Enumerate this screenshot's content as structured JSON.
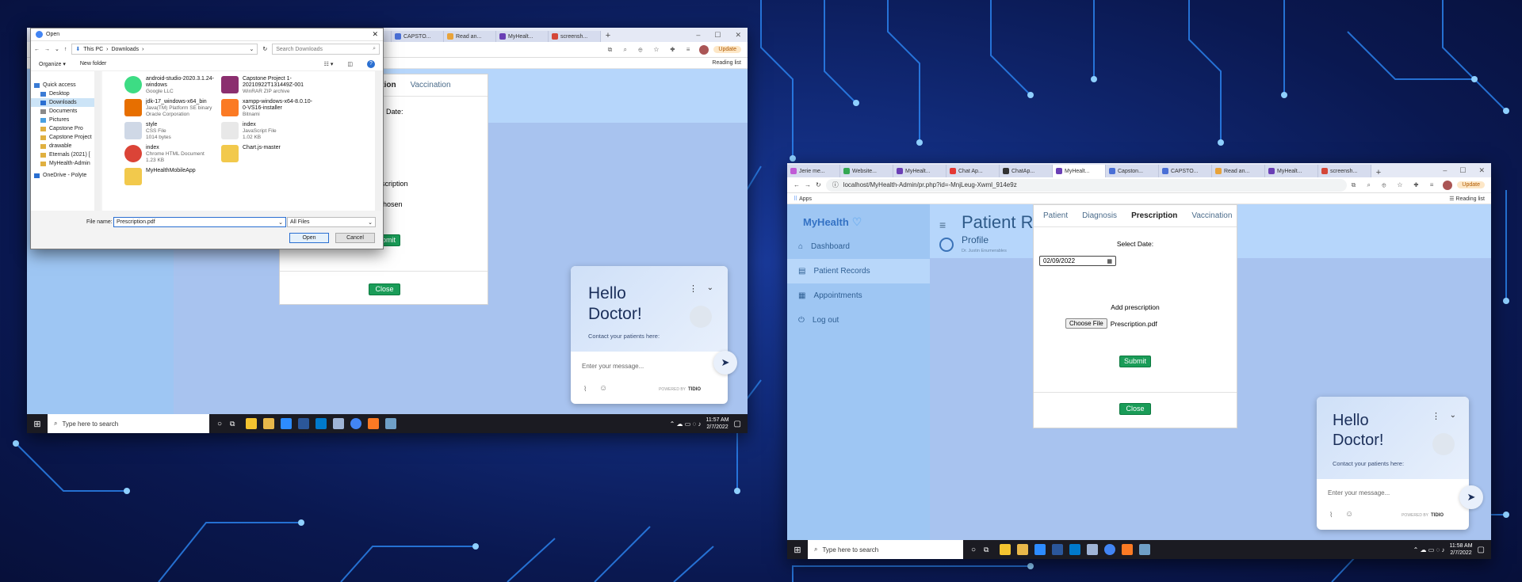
{
  "window1": {
    "tabs": [
      "...",
      "CAPSTO...",
      "Read an...",
      "MyHealt...",
      "screensh..."
    ],
    "reading_list": "Reading list",
    "update_label": "Update",
    "modal": {
      "tabs": [
        "...scription",
        "Vaccination"
      ],
      "select_date_label": "Date:",
      "prescription_label": "scription",
      "no_file_text": "hosen",
      "submit_label": "Submit",
      "close_label": "Close"
    },
    "chat": {
      "greeting": "Hello Doctor!",
      "subtitle": "Contact your patients here:",
      "placeholder": "Enter your message...",
      "powered_by": "POWERED BY",
      "brand": "TIDIO"
    },
    "taskbar": {
      "search": "Type here to search",
      "time": "11:57 AM",
      "date": "2/7/2022"
    }
  },
  "dialog": {
    "title": "Open",
    "breadcrumb": [
      "This PC",
      "Downloads"
    ],
    "search_placeholder": "Search Downloads",
    "organize": "Organize ▾",
    "new_folder": "New folder",
    "nav_items": [
      {
        "label": "Quick access",
        "color": "#3a7bd5"
      },
      {
        "label": "Desktop",
        "color": "#3a7bd5"
      },
      {
        "label": "Downloads",
        "color": "#2a6fd1"
      },
      {
        "label": "Documents",
        "color": "#8a8a8a"
      },
      {
        "label": "Pictures",
        "color": "#4aa0e0"
      },
      {
        "label": "Capstone Pro",
        "color": "#e0b040"
      },
      {
        "label": "Capstone Project",
        "color": "#e0b040"
      },
      {
        "label": "drawable",
        "color": "#e0b040"
      },
      {
        "label": "Eternals (2021) [",
        "color": "#e0b040"
      },
      {
        "label": "MyHealth-Admin",
        "color": "#e0b040"
      },
      {
        "label": "OneDrive - Polyte",
        "color": "#2a6fd1"
      }
    ],
    "files": [
      {
        "name": "android-studio-2020.3.1.24-windows",
        "sub1": "Google LLC",
        "sub2": "",
        "color": "#3ddc84"
      },
      {
        "name": "Capstone Project 1-20210922T131449Z-001",
        "sub1": "WinRAR ZIP archive",
        "sub2": "",
        "color": "#8b2f6f"
      },
      {
        "name": "jdk-17_windows-x64_bin",
        "sub1": "Java(TM) Platform SE binary",
        "sub2": "Oracle Corporation",
        "color": "#e76f00"
      },
      {
        "name": "xampp-windows-x64-8.0.10-0-VS16-installer",
        "sub1": "Bitnami",
        "sub2": "",
        "color": "#fb7a24"
      },
      {
        "name": "style",
        "sub1": "CSS File",
        "sub2": "1014 bytes",
        "color": "#cfd8e6"
      },
      {
        "name": "index",
        "sub1": "JavaScript File",
        "sub2": "1.02 KB",
        "color": "#e8e8e8"
      },
      {
        "name": "index",
        "sub1": "Chrome HTML Document",
        "sub2": "1.23 KB",
        "color": "#db4437"
      },
      {
        "name": "Chart.js-master",
        "sub1": "",
        "sub2": "",
        "color": "#f2c94c"
      },
      {
        "name": "MyHealthMobileApp",
        "sub1": "",
        "sub2": "",
        "color": "#f2c94c"
      }
    ],
    "file_name_label": "File name:",
    "file_name_value": "Prescription.pdf",
    "file_type": "All Files",
    "open_label": "Open",
    "cancel_label": "Cancel"
  },
  "window2": {
    "tabs": [
      "Jerie me...",
      "Website...",
      "MyHealt...",
      "Chat Ap...",
      "ChatAp...",
      "MyHealt...",
      "Capston...",
      "CAPSTO...",
      "Read an...",
      "MyHealt...",
      "screensh..."
    ],
    "url": "localhost/MyHealth-Admin/pr.php?id=-MnjLeug-Xwml_914e9z",
    "apps_label": "Apps",
    "reading_list": "Reading list",
    "update_label": "Update",
    "brand": "MyHealth",
    "menu": [
      "Dashboard",
      "Patient Records",
      "Appointments",
      "Log out"
    ],
    "page_title": "Patient R",
    "profile_label": "Profile",
    "doctor_name": "Dr. Justin Enumerables",
    "modal": {
      "tabs": [
        "Patient",
        "Diagnosis",
        "Prescription",
        "Vaccination"
      ],
      "select_date_label": "Select Date:",
      "date_value": "02/09/2022",
      "add_prescription_label": "Add prescription",
      "choose_file_label": "Choose File",
      "chosen_file": "Prescription.pdf",
      "submit_label": "Submit",
      "close_label": "Close"
    },
    "chat": {
      "greeting": "Hello Doctor!",
      "subtitle": "Contact your patients here:",
      "placeholder": "Enter your message...",
      "powered_by": "POWERED BY",
      "brand": "TIDIO"
    },
    "taskbar": {
      "search": "Type here to search",
      "time": "11:58 AM",
      "date": "2/7/2022"
    }
  }
}
